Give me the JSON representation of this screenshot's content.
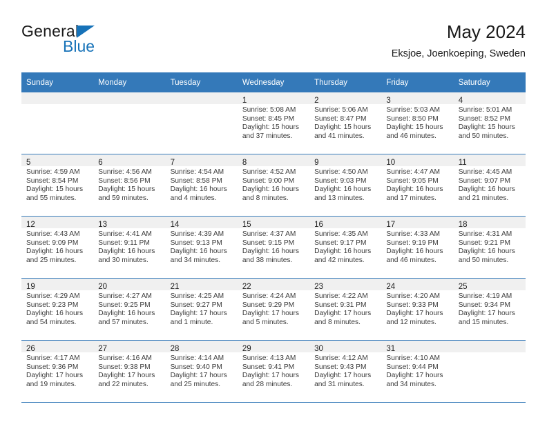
{
  "logo": {
    "word_top": "General",
    "word_bottom": "Blue",
    "triangle_color": "#1672b8",
    "text_color": "#1a1a1a"
  },
  "header": {
    "title": "May 2024",
    "location": "Eksjoe, Joenkoeping, Sweden",
    "accent_color": "#3479b9"
  },
  "weekday_headers": [
    "Sunday",
    "Monday",
    "Tuesday",
    "Wednesday",
    "Thursday",
    "Friday",
    "Saturday"
  ],
  "labels": {
    "sunrise": "Sunrise:",
    "sunset": "Sunset:",
    "daylight": "Daylight:"
  },
  "weeks": [
    [
      {
        "day": "",
        "empty": true
      },
      {
        "day": "",
        "empty": true
      },
      {
        "day": "",
        "empty": true
      },
      {
        "day": "1",
        "sunrise": "Sunrise: 5:08 AM",
        "sunset": "Sunset: 8:45 PM",
        "daylight1": "Daylight: 15 hours",
        "daylight2": "and 37 minutes."
      },
      {
        "day": "2",
        "sunrise": "Sunrise: 5:06 AM",
        "sunset": "Sunset: 8:47 PM",
        "daylight1": "Daylight: 15 hours",
        "daylight2": "and 41 minutes."
      },
      {
        "day": "3",
        "sunrise": "Sunrise: 5:03 AM",
        "sunset": "Sunset: 8:50 PM",
        "daylight1": "Daylight: 15 hours",
        "daylight2": "and 46 minutes."
      },
      {
        "day": "4",
        "sunrise": "Sunrise: 5:01 AM",
        "sunset": "Sunset: 8:52 PM",
        "daylight1": "Daylight: 15 hours",
        "daylight2": "and 50 minutes."
      }
    ],
    [
      {
        "day": "5",
        "sunrise": "Sunrise: 4:59 AM",
        "sunset": "Sunset: 8:54 PM",
        "daylight1": "Daylight: 15 hours",
        "daylight2": "and 55 minutes."
      },
      {
        "day": "6",
        "sunrise": "Sunrise: 4:56 AM",
        "sunset": "Sunset: 8:56 PM",
        "daylight1": "Daylight: 15 hours",
        "daylight2": "and 59 minutes."
      },
      {
        "day": "7",
        "sunrise": "Sunrise: 4:54 AM",
        "sunset": "Sunset: 8:58 PM",
        "daylight1": "Daylight: 16 hours",
        "daylight2": "and 4 minutes."
      },
      {
        "day": "8",
        "sunrise": "Sunrise: 4:52 AM",
        "sunset": "Sunset: 9:00 PM",
        "daylight1": "Daylight: 16 hours",
        "daylight2": "and 8 minutes."
      },
      {
        "day": "9",
        "sunrise": "Sunrise: 4:50 AM",
        "sunset": "Sunset: 9:03 PM",
        "daylight1": "Daylight: 16 hours",
        "daylight2": "and 13 minutes."
      },
      {
        "day": "10",
        "sunrise": "Sunrise: 4:47 AM",
        "sunset": "Sunset: 9:05 PM",
        "daylight1": "Daylight: 16 hours",
        "daylight2": "and 17 minutes."
      },
      {
        "day": "11",
        "sunrise": "Sunrise: 4:45 AM",
        "sunset": "Sunset: 9:07 PM",
        "daylight1": "Daylight: 16 hours",
        "daylight2": "and 21 minutes."
      }
    ],
    [
      {
        "day": "12",
        "sunrise": "Sunrise: 4:43 AM",
        "sunset": "Sunset: 9:09 PM",
        "daylight1": "Daylight: 16 hours",
        "daylight2": "and 25 minutes."
      },
      {
        "day": "13",
        "sunrise": "Sunrise: 4:41 AM",
        "sunset": "Sunset: 9:11 PM",
        "daylight1": "Daylight: 16 hours",
        "daylight2": "and 30 minutes."
      },
      {
        "day": "14",
        "sunrise": "Sunrise: 4:39 AM",
        "sunset": "Sunset: 9:13 PM",
        "daylight1": "Daylight: 16 hours",
        "daylight2": "and 34 minutes."
      },
      {
        "day": "15",
        "sunrise": "Sunrise: 4:37 AM",
        "sunset": "Sunset: 9:15 PM",
        "daylight1": "Daylight: 16 hours",
        "daylight2": "and 38 minutes."
      },
      {
        "day": "16",
        "sunrise": "Sunrise: 4:35 AM",
        "sunset": "Sunset: 9:17 PM",
        "daylight1": "Daylight: 16 hours",
        "daylight2": "and 42 minutes."
      },
      {
        "day": "17",
        "sunrise": "Sunrise: 4:33 AM",
        "sunset": "Sunset: 9:19 PM",
        "daylight1": "Daylight: 16 hours",
        "daylight2": "and 46 minutes."
      },
      {
        "day": "18",
        "sunrise": "Sunrise: 4:31 AM",
        "sunset": "Sunset: 9:21 PM",
        "daylight1": "Daylight: 16 hours",
        "daylight2": "and 50 minutes."
      }
    ],
    [
      {
        "day": "19",
        "sunrise": "Sunrise: 4:29 AM",
        "sunset": "Sunset: 9:23 PM",
        "daylight1": "Daylight: 16 hours",
        "daylight2": "and 54 minutes."
      },
      {
        "day": "20",
        "sunrise": "Sunrise: 4:27 AM",
        "sunset": "Sunset: 9:25 PM",
        "daylight1": "Daylight: 16 hours",
        "daylight2": "and 57 minutes."
      },
      {
        "day": "21",
        "sunrise": "Sunrise: 4:25 AM",
        "sunset": "Sunset: 9:27 PM",
        "daylight1": "Daylight: 17 hours",
        "daylight2": "and 1 minute."
      },
      {
        "day": "22",
        "sunrise": "Sunrise: 4:24 AM",
        "sunset": "Sunset: 9:29 PM",
        "daylight1": "Daylight: 17 hours",
        "daylight2": "and 5 minutes."
      },
      {
        "day": "23",
        "sunrise": "Sunrise: 4:22 AM",
        "sunset": "Sunset: 9:31 PM",
        "daylight1": "Daylight: 17 hours",
        "daylight2": "and 8 minutes."
      },
      {
        "day": "24",
        "sunrise": "Sunrise: 4:20 AM",
        "sunset": "Sunset: 9:33 PM",
        "daylight1": "Daylight: 17 hours",
        "daylight2": "and 12 minutes."
      },
      {
        "day": "25",
        "sunrise": "Sunrise: 4:19 AM",
        "sunset": "Sunset: 9:34 PM",
        "daylight1": "Daylight: 17 hours",
        "daylight2": "and 15 minutes."
      }
    ],
    [
      {
        "day": "26",
        "sunrise": "Sunrise: 4:17 AM",
        "sunset": "Sunset: 9:36 PM",
        "daylight1": "Daylight: 17 hours",
        "daylight2": "and 19 minutes."
      },
      {
        "day": "27",
        "sunrise": "Sunrise: 4:16 AM",
        "sunset": "Sunset: 9:38 PM",
        "daylight1": "Daylight: 17 hours",
        "daylight2": "and 22 minutes."
      },
      {
        "day": "28",
        "sunrise": "Sunrise: 4:14 AM",
        "sunset": "Sunset: 9:40 PM",
        "daylight1": "Daylight: 17 hours",
        "daylight2": "and 25 minutes."
      },
      {
        "day": "29",
        "sunrise": "Sunrise: 4:13 AM",
        "sunset": "Sunset: 9:41 PM",
        "daylight1": "Daylight: 17 hours",
        "daylight2": "and 28 minutes."
      },
      {
        "day": "30",
        "sunrise": "Sunrise: 4:12 AM",
        "sunset": "Sunset: 9:43 PM",
        "daylight1": "Daylight: 17 hours",
        "daylight2": "and 31 minutes."
      },
      {
        "day": "31",
        "sunrise": "Sunrise: 4:10 AM",
        "sunset": "Sunset: 9:44 PM",
        "daylight1": "Daylight: 17 hours",
        "daylight2": "and 34 minutes."
      },
      {
        "day": "",
        "empty": true
      }
    ]
  ]
}
